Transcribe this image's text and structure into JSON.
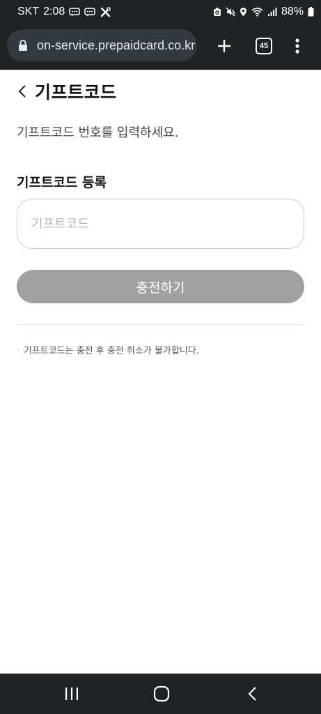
{
  "status_bar": {
    "carrier": "SKT",
    "time": "2:08",
    "battery": "88%",
    "left_icons": [
      "chat-icon",
      "chat-icon",
      "tools-icon"
    ],
    "right_icons": [
      "sync-icon",
      "mute-icon",
      "location-icon",
      "wifi-icon",
      "signal-icon",
      "battery-icon"
    ]
  },
  "browser": {
    "url": "on-service.prepaidcard.co.kr",
    "tab_count": "45",
    "icons": {
      "lock": "lock-icon",
      "new_tab": "plus-icon",
      "menu": "more-vert-icon"
    }
  },
  "page": {
    "title": "기프트코드",
    "instruction": "기프트코드 번호를 입력하세요.",
    "section_label": "기프트코드 등록",
    "input": {
      "placeholder": "기프트코드",
      "value": ""
    },
    "charge_button": "충전하기",
    "notice_bullet": "·",
    "notice": "기프트코드는 충전 후 충전 취소가 불가합니다."
  },
  "nav_bar": {
    "icons": [
      "recent-apps-icon",
      "home-icon",
      "back-icon"
    ]
  },
  "colors": {
    "system_bar": "#1f2326",
    "url_pill": "#323a3f",
    "button_disabled": "#a0a0a0",
    "input_border": "#cccccc"
  }
}
